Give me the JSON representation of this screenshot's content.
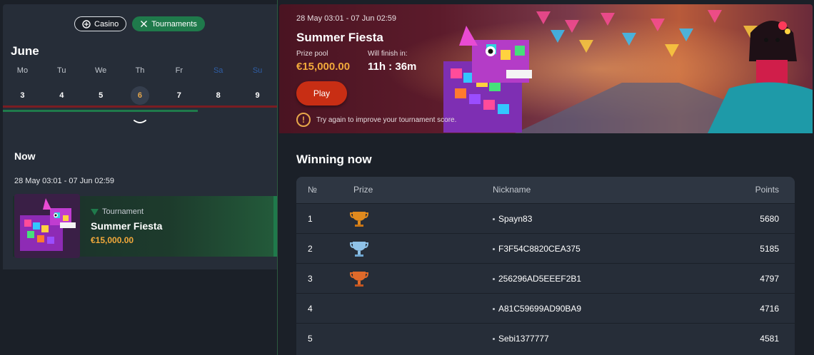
{
  "filters": {
    "casino_label": "Casino",
    "tournaments_label": "Tournaments"
  },
  "calendar": {
    "month": "June",
    "days": [
      {
        "dow": "Mo",
        "num": "3"
      },
      {
        "dow": "Tu",
        "num": "4"
      },
      {
        "dow": "We",
        "num": "5"
      },
      {
        "dow": "Th",
        "num": "6"
      },
      {
        "dow": "Fr",
        "num": "7"
      },
      {
        "dow": "Sa",
        "num": "8"
      },
      {
        "dow": "Su",
        "num": "9"
      }
    ]
  },
  "now": {
    "title": "Now",
    "dates": "28 May 03:01 - 07 Jun 02:59",
    "card": {
      "type_label": "Tournament",
      "name": "Summer Fiesta",
      "prize": "€15,000.00"
    }
  },
  "hero": {
    "dates": "28 May 03:01 - 07 Jun 02:59",
    "title": "Summer Fiesta",
    "prize_pool_label": "Prize pool",
    "prize_pool_value": "€15,000.00",
    "finish_label": "Will finish in:",
    "finish_value": "11h : 36m",
    "play_label": "Play",
    "info_text": "Try again to improve your tournament score."
  },
  "leaderboard": {
    "title": "Winning now",
    "headers": {
      "no": "№",
      "prize": "Prize",
      "nickname": "Nickname",
      "points": "Points"
    },
    "rows": [
      {
        "no": "1",
        "cup": "gold",
        "nickname": "Spayn83",
        "points": "5680"
      },
      {
        "no": "2",
        "cup": "silver",
        "nickname": "F3F54C8820CEA375",
        "points": "5185"
      },
      {
        "no": "3",
        "cup": "bronze",
        "nickname": "256296AD5EEEF2B1",
        "points": "4797"
      },
      {
        "no": "4",
        "cup": "",
        "nickname": "A81C59699AD90BA9",
        "points": "4716"
      },
      {
        "no": "5",
        "cup": "",
        "nickname": "Sebi1377777",
        "points": "4581"
      }
    ]
  },
  "colors": {
    "accent_green": "#1f7a4b",
    "prize_orange": "#f2a93b",
    "play_red": "#c82e14",
    "today_orange": "#e8a84a"
  }
}
